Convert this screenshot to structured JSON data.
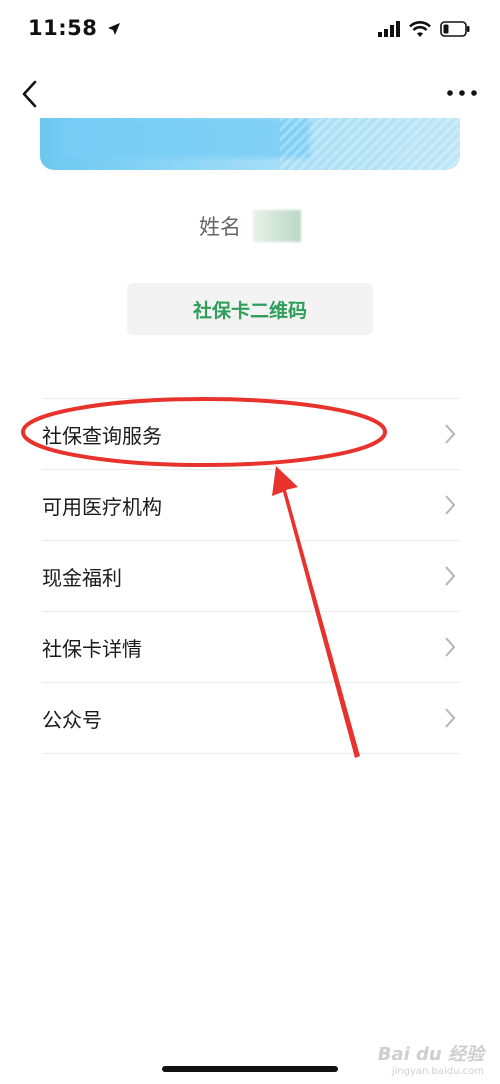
{
  "status_bar": {
    "time": "11:58"
  },
  "profile": {
    "name_label": "姓名"
  },
  "qr_button": {
    "label": "社保卡二维码"
  },
  "menu": {
    "items": [
      {
        "label": "社保查询服务"
      },
      {
        "label": "可用医疗机构"
      },
      {
        "label": "现金福利"
      },
      {
        "label": "社保卡详情"
      },
      {
        "label": "公众号"
      }
    ]
  },
  "watermark": {
    "text": "Bai du 经验",
    "sub": "jingyan.baidu.com"
  },
  "colors": {
    "accent_green": "#2f9e5c",
    "annotation_red": "#e8322c"
  }
}
